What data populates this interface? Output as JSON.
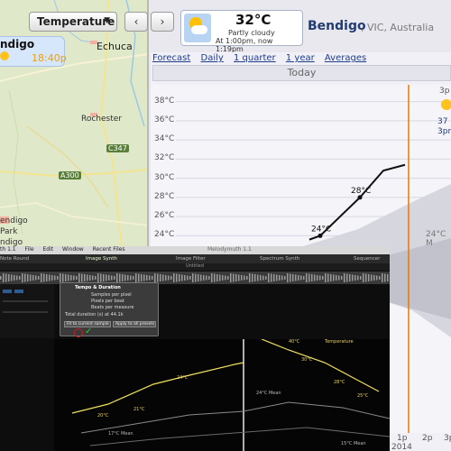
{
  "map": {
    "city": "ndigo",
    "time": "18:40p",
    "places": [
      "Echuca",
      "Rochester",
      "endigo",
      "Park",
      "ndigo"
    ],
    "roads": [
      "C347",
      "A300"
    ]
  },
  "toolbar": {
    "dropdown_label": "Temperature",
    "prev_label": "‹",
    "next_label": "›"
  },
  "weather": {
    "temp": "32°C",
    "condition": "Partly cloudy",
    "time_text": "At 1:00pm, now 1:19pm"
  },
  "location": {
    "name": "Bendigo",
    "region": ", VIC, Australia"
  },
  "forecast": {
    "tabs": [
      "Forecast",
      "Daily",
      "1 quarter",
      "1 year",
      "Averages"
    ],
    "day_label": "Today",
    "right_cut_time": "3p",
    "right_cut_temp": "37",
    "right_cut_time2": "3pn",
    "mean_label": "24°C M",
    "bottom_times": [
      "1p",
      "2p",
      "3p"
    ],
    "bottom_year": "2014"
  },
  "chart_data": {
    "type": "line",
    "title": "",
    "xlabel": "",
    "ylabel": "",
    "yticks": [
      "38°C",
      "36°C",
      "34°C",
      "32°C",
      "30°C",
      "28°C",
      "26°C",
      "24°C"
    ],
    "ylim": [
      23,
      39
    ],
    "series": [
      {
        "name": "",
        "points": [
          [
            0,
            23.6
          ],
          [
            1,
            24
          ],
          [
            2,
            28
          ],
          [
            3,
            30.8
          ],
          [
            4,
            31.4
          ]
        ]
      }
    ],
    "labels": [
      "24°C",
      "28°C"
    ]
  },
  "app": {
    "menu_items": [
      "th 1.1",
      "File",
      "Edit",
      "Window",
      "Recent Files"
    ],
    "window_title": "Melodymuth 1.1",
    "tabs": [
      "Note Round",
      "Image Synth",
      "Image Filter",
      "Spectrum Synth",
      "Sequencer"
    ],
    "active_tab": "Image Synth",
    "document": "Untitled",
    "dialog_title": "Tempo & Duration",
    "dialog_rows": [
      "Samples per pixel",
      "Pixels per beat",
      "Beats per measure",
      "Total duration (s) at 44.1k"
    ],
    "dialog_buttons": [
      "Fit to current sample",
      "Apply to all presets"
    ],
    "graph_labels": [
      "20°C",
      "21°C",
      "24°C",
      "30°C",
      "28°C",
      "25°C",
      "24°C Mean",
      "17°C Mean",
      "15°C Mean",
      "40°C",
      "Temperature"
    ]
  }
}
